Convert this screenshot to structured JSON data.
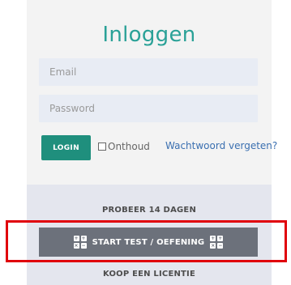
{
  "login": {
    "title": "Inloggen",
    "email_placeholder": "Email",
    "password_placeholder": "Password",
    "login_button": "LOGIN",
    "remember_label": "Onthoud",
    "remember_checked": false,
    "forgot_link": "Wachtwoord vergeten?"
  },
  "actions": {
    "try_label": "PROBEER 14 DAGEN",
    "start_label": "START TEST / OEFENING",
    "buy_label": "KOOP EEN LICENTIE"
  },
  "icons": {
    "start_left": "grid-plus-minus-icon",
    "start_right": "grid-plus-minus-icon"
  },
  "colors": {
    "accent": "#2aa197",
    "login_button": "#1f8f7d",
    "start_button": "#6c717b",
    "highlight": "#e0000b",
    "link": "#3a6fb0"
  }
}
